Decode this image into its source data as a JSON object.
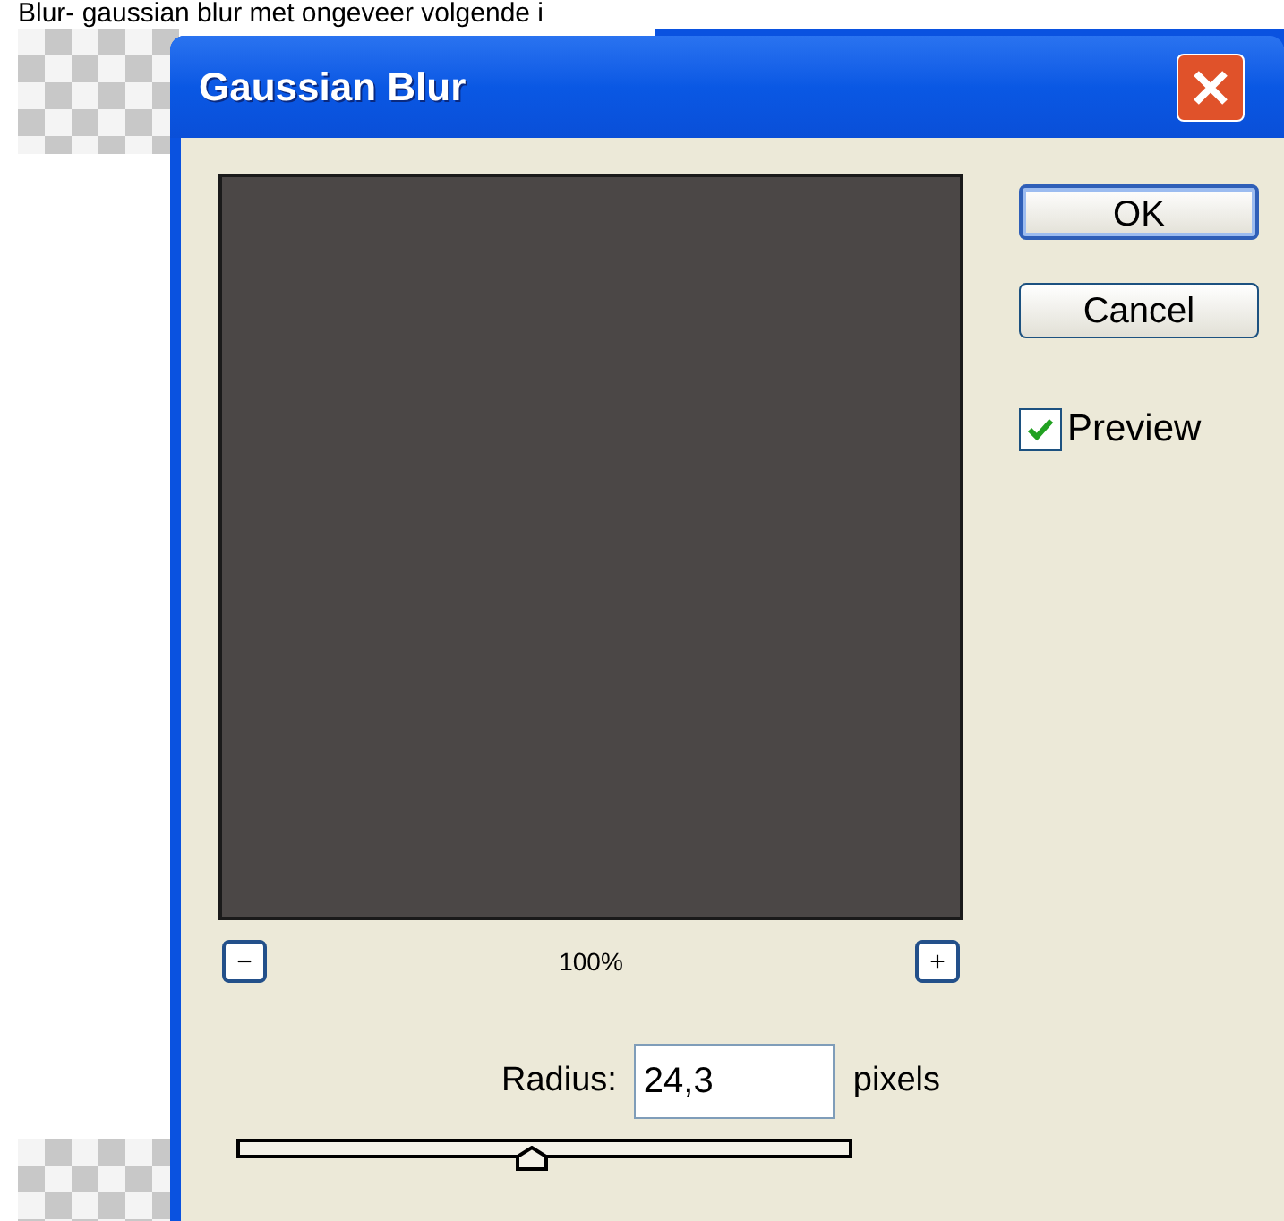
{
  "background_caption": "Blur- gaussian blur met ongeveer volgende i",
  "dialog": {
    "title": "Gaussian Blur",
    "buttons": [
      {
        "label": "OK",
        "default": true
      },
      {
        "label": "Cancel",
        "default": false
      }
    ],
    "preview_checkbox": {
      "label": "Preview",
      "checked": true
    },
    "zoom": {
      "minus": "−",
      "plus": "+",
      "percent": "100%"
    },
    "radius": {
      "label": "Radius:",
      "value": "24,3",
      "unit": "pixels",
      "level": 0.48
    }
  }
}
